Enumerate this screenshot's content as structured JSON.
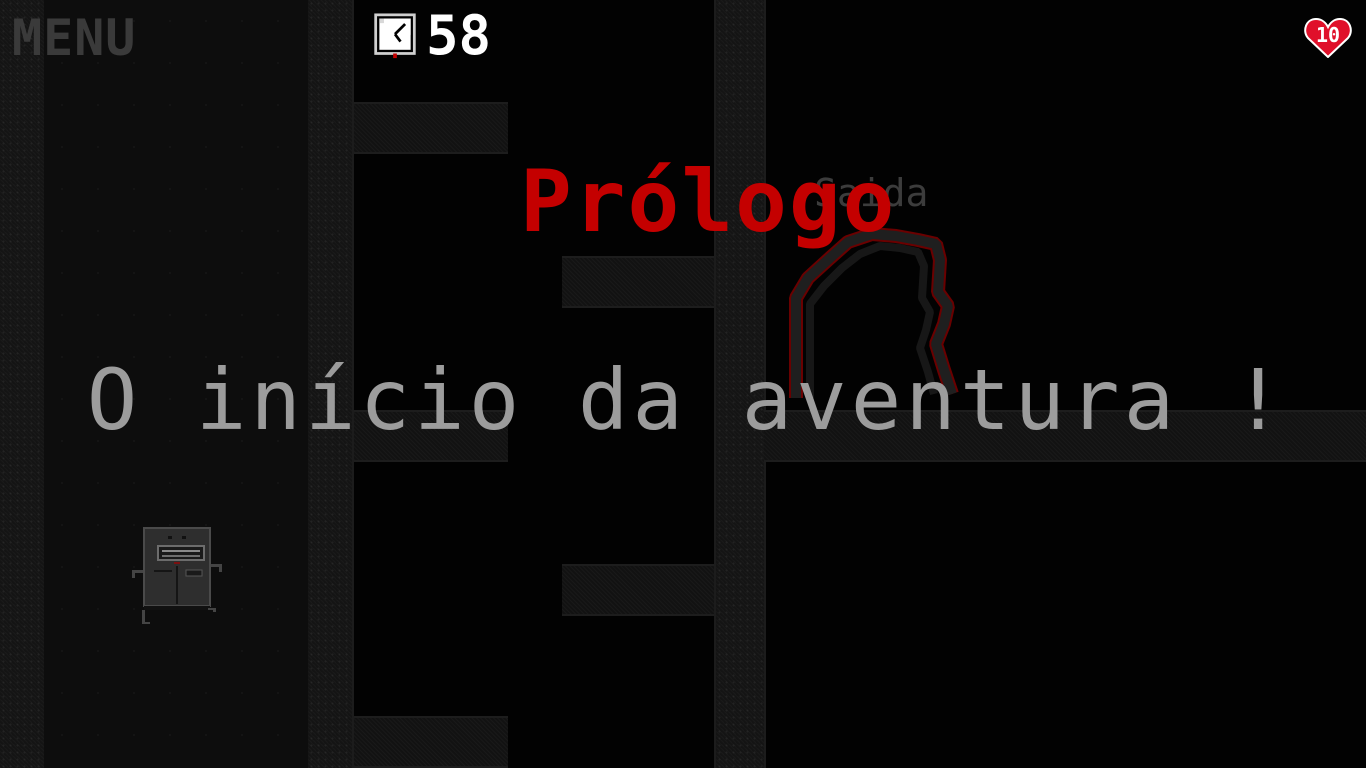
{
  "hud": {
    "menu_label": "MENU",
    "timer_value": "58",
    "lives_count": "10",
    "timer_icon": "clock-icon",
    "lives_icon": "heart-icon"
  },
  "chapter": {
    "title": "Prólogo",
    "subtitle": "O início da aventura !"
  },
  "level": {
    "exit_label": "Saida"
  },
  "colors": {
    "background": "#020202",
    "title_red": "#c40000",
    "subtitle_gray": "#9c9c9c",
    "heart_red": "#e0102a",
    "hud_white": "#ffffff"
  }
}
